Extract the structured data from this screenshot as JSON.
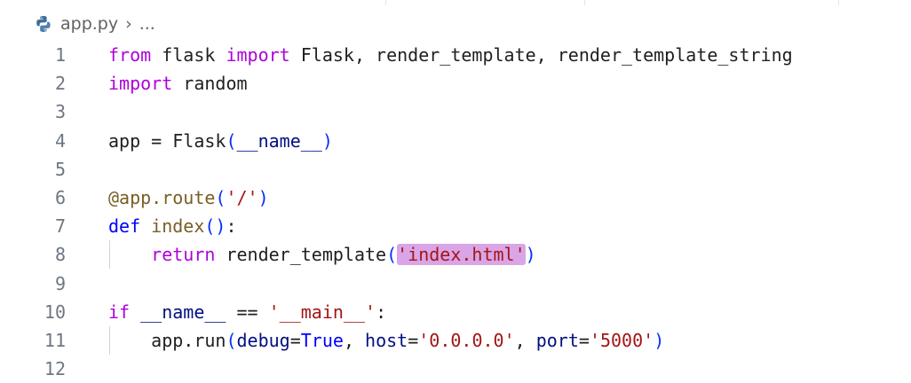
{
  "breadcrumb": {
    "file_icon": "python-icon",
    "file_name": "app.py",
    "separator": "›",
    "ellipsis": "..."
  },
  "colors": {
    "keyword": "#af00db",
    "def_keyword": "#0000ff",
    "function": "#795e26",
    "string": "#a31515",
    "highlight": "#d9a5e6",
    "line_number": "#6e7681"
  },
  "editor": {
    "lines": [
      {
        "n": "1",
        "t": [
          [
            "kw",
            "from"
          ],
          [
            "op",
            " flask "
          ],
          [
            "kw",
            "import"
          ],
          [
            "op",
            " Flask, render_template, render_template_string"
          ]
        ]
      },
      {
        "n": "2",
        "t": [
          [
            "kw",
            "import"
          ],
          [
            "op",
            " random"
          ]
        ]
      },
      {
        "n": "3",
        "t": []
      },
      {
        "n": "4",
        "t": [
          [
            "op",
            "app = Flask"
          ],
          [
            "br1",
            "("
          ],
          [
            "var",
            "__name__"
          ],
          [
            "br1",
            ")"
          ]
        ]
      },
      {
        "n": "5",
        "t": []
      },
      {
        "n": "6",
        "t": [
          [
            "fn",
            "@app.route"
          ],
          [
            "br1",
            "("
          ],
          [
            "str",
            "'/'"
          ],
          [
            "br1",
            ")"
          ]
        ]
      },
      {
        "n": "7",
        "t": [
          [
            "kw2",
            "def"
          ],
          [
            "op",
            " "
          ],
          [
            "fn",
            "index"
          ],
          [
            "br1",
            "()"
          ],
          [
            "op",
            ":"
          ]
        ]
      },
      {
        "n": "8",
        "guide": true,
        "t": [
          [
            "op",
            "    "
          ],
          [
            "kw",
            "return"
          ],
          [
            "op",
            " render_template"
          ],
          [
            "br1",
            "("
          ],
          [
            "hl",
            "'index.html'"
          ],
          [
            "br1",
            ")"
          ]
        ]
      },
      {
        "n": "9",
        "t": []
      },
      {
        "n": "10",
        "t": [
          [
            "kw",
            "if"
          ],
          [
            "op",
            " "
          ],
          [
            "var",
            "__name__"
          ],
          [
            "op",
            " == "
          ],
          [
            "str",
            "'__main__'"
          ],
          [
            "op",
            ":"
          ]
        ]
      },
      {
        "n": "11",
        "guide": true,
        "t": [
          [
            "op",
            "    app.run"
          ],
          [
            "br1",
            "("
          ],
          [
            "var",
            "debug"
          ],
          [
            "op",
            "="
          ],
          [
            "kw2",
            "True"
          ],
          [
            "op",
            ", "
          ],
          [
            "var",
            "host"
          ],
          [
            "op",
            "="
          ],
          [
            "str",
            "'0.0.0.0'"
          ],
          [
            "op",
            ", "
          ],
          [
            "var",
            "port"
          ],
          [
            "op",
            "="
          ],
          [
            "str",
            "'5000'"
          ],
          [
            "br1",
            ")"
          ]
        ]
      },
      {
        "n": "12",
        "t": []
      }
    ]
  }
}
